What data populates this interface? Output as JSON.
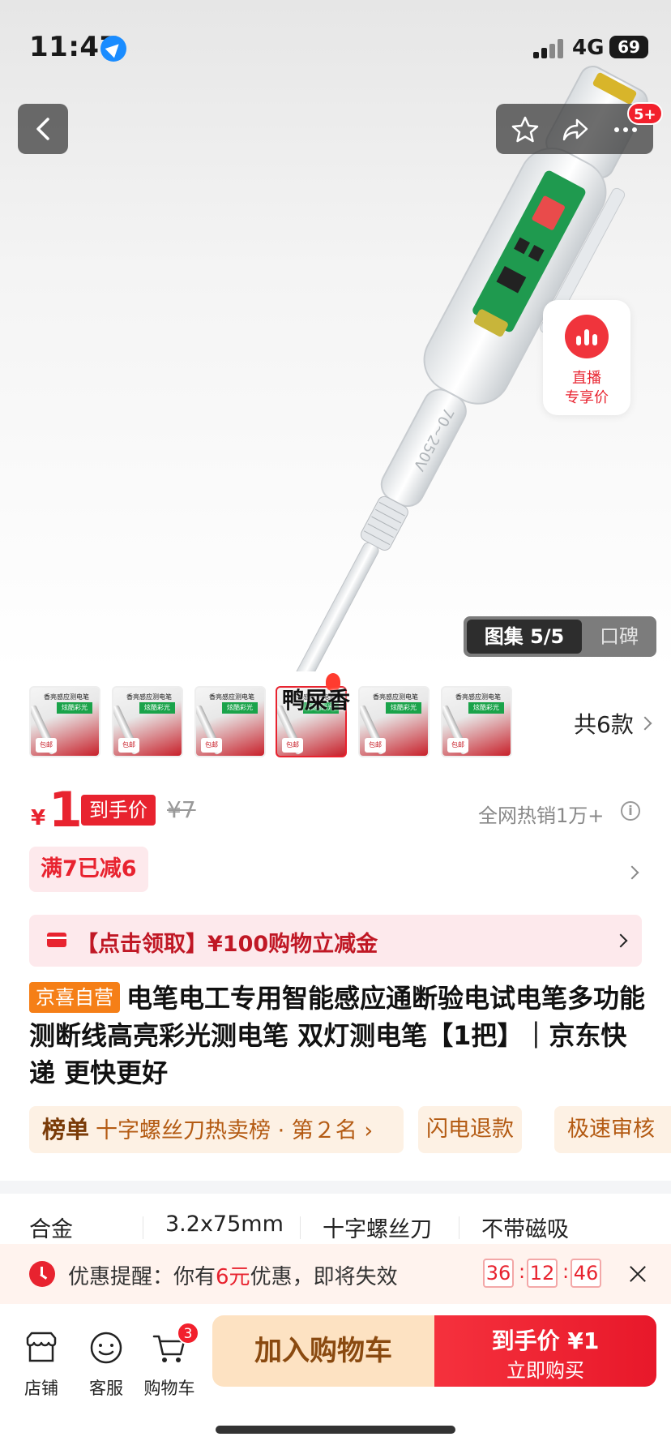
{
  "status_bar": {
    "time": "11:47",
    "network": "4G",
    "battery": "69"
  },
  "header": {
    "more_badge": "5+"
  },
  "live_card": {
    "line1": "直播",
    "line2": "专享价"
  },
  "gallery": {
    "active_tab": "图集 5/5",
    "other_tab": "口碑"
  },
  "variants": {
    "thumb_text_top": "香亮感应测电笔",
    "thumb_text_green": "炫酷彩光",
    "thumb_tag": "包邮",
    "selected_label": "鸭屎香",
    "count": "共6款"
  },
  "price": {
    "currency": "¥",
    "value": "1",
    "tag": "到手价",
    "original": "¥7",
    "sold": "全网热销1万+",
    "info_icon": "i"
  },
  "promo": {
    "label": "满7已减6"
  },
  "coupon": {
    "text": "【点击领取】¥100购物立减金"
  },
  "product": {
    "shop_tag": "京喜自营",
    "title": "电笔电工专用智能感应通断验电试电笔多功能测断线高亮彩光测电笔 双灯测电笔【1把】｜京东快递 更快更好"
  },
  "chips": [
    {
      "bold": "榜单",
      "text": "十字螺丝刀热卖榜 · 第２名 ›"
    },
    {
      "bold": "",
      "text": "闪电退款"
    },
    {
      "bold": "",
      "text": "极速审核"
    }
  ],
  "specs": [
    "合金",
    "3.2x75mm",
    "十字螺丝刀",
    "不带磁吸"
  ],
  "reminder": {
    "prefix": "优惠提醒：你有",
    "amount": "6元",
    "suffix": "优惠，即将失效",
    "hours": "36",
    "minutes": "12",
    "seconds": "46",
    "sep": ":"
  },
  "bottom_nav": {
    "shop": "店铺",
    "service": "客服",
    "cart": "购物车",
    "cart_badge": "3",
    "add_to_cart": "加入购物车",
    "buy_line1": "到手价 ¥1",
    "buy_line2": "立即购买"
  },
  "colors": {
    "accent_red": "#e8232f",
    "promo_bg": "#fde9ec",
    "cart_btn_bg": "#fde2c2",
    "shop_tag_orange": "#f57f17"
  },
  "icons": [
    "back-icon",
    "star-icon",
    "share-icon",
    "more-icon",
    "live-icon",
    "coupon-card-icon",
    "info-icon",
    "clock-icon",
    "close-icon",
    "store-icon",
    "service-icon",
    "cart-icon"
  ]
}
